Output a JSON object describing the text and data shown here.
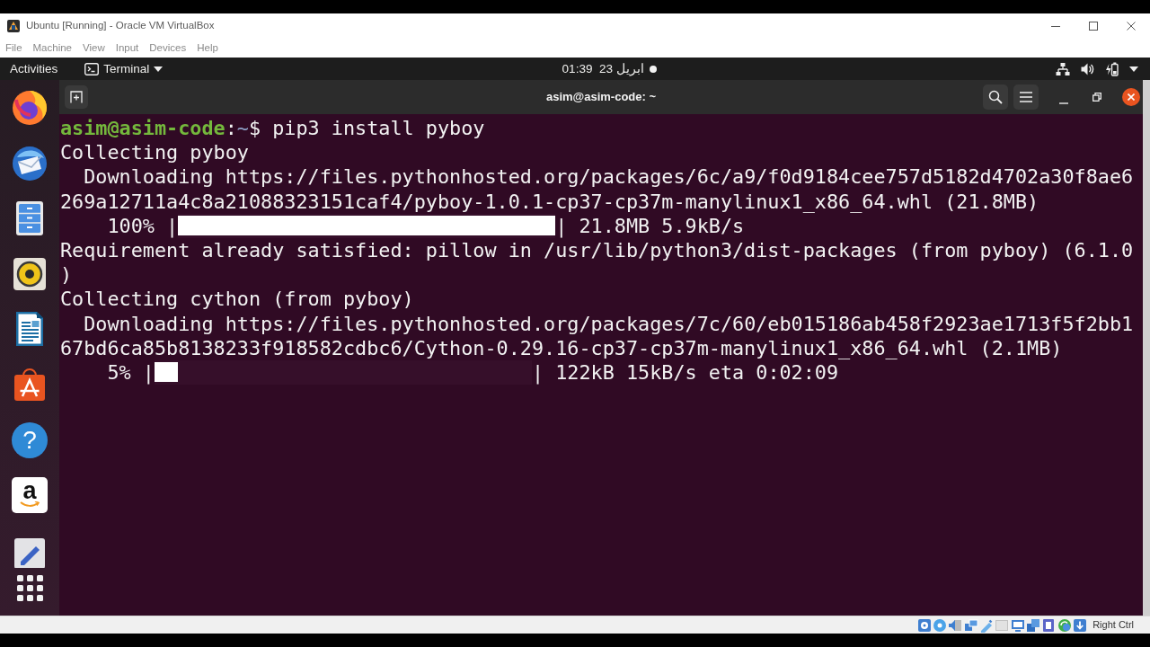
{
  "window": {
    "title": "Ubuntu [Running] - Oracle VM VirtualBox"
  },
  "menu": [
    "File",
    "Machine",
    "View",
    "Input",
    "Devices",
    "Help"
  ],
  "top_bar": {
    "activities": "Activities",
    "app_menu": "Terminal",
    "time": "01:39",
    "date": "23 ابريل",
    "unread_notifications": true
  },
  "dock": {
    "help_glyph": "?",
    "store_glyph": "a"
  },
  "terminal": {
    "title": "asim@asim-code: ~",
    "lines": [
      {
        "kind": "prompt",
        "user": "asim@asim-code",
        "separator": ":",
        "path": "~",
        "symbol": "$",
        "command": "pip3 install pyboy"
      },
      {
        "kind": "text",
        "text": "Collecting pyboy"
      },
      {
        "kind": "text",
        "text": "  Downloading https://files.pythonhosted.org/packages/6c/a9/f0d9184cee757d5182d4702a30f8ae6"
      },
      {
        "kind": "text",
        "text": "269a12711a4c8a21088323151caf4/pyboy-1.0.1-cp37-cp37m-manylinux1_x86_64.whl (21.8MB)"
      },
      {
        "kind": "progress",
        "label": "    100% |",
        "level": 1,
        "stats": "| 21.8MB 5.9kB/s"
      },
      {
        "kind": "text",
        "text": "Requirement already satisfied: pillow in /usr/lib/python3/dist-packages (from pyboy) (6.1.0"
      },
      {
        "kind": "text",
        "text": ")"
      },
      {
        "kind": "text",
        "text": "Collecting cython (from pyboy)"
      },
      {
        "kind": "text",
        "text": "  Downloading https://files.pythonhosted.org/packages/7c/60/eb015186ab458f2923ae1713f5f2bb1"
      },
      {
        "kind": "text",
        "text": "67bd6ca85b8138233f918582cdbc6/Cython-0.29.16-cp37-cp37m-manylinux1_x86_64.whl (2.1MB)"
      },
      {
        "kind": "progress",
        "label": "    5% |",
        "level": 0.05,
        "stats": "| 122kB 15kB/s eta 0:02:09"
      }
    ]
  },
  "status_bar": {
    "host_key": "Right Ctrl"
  }
}
